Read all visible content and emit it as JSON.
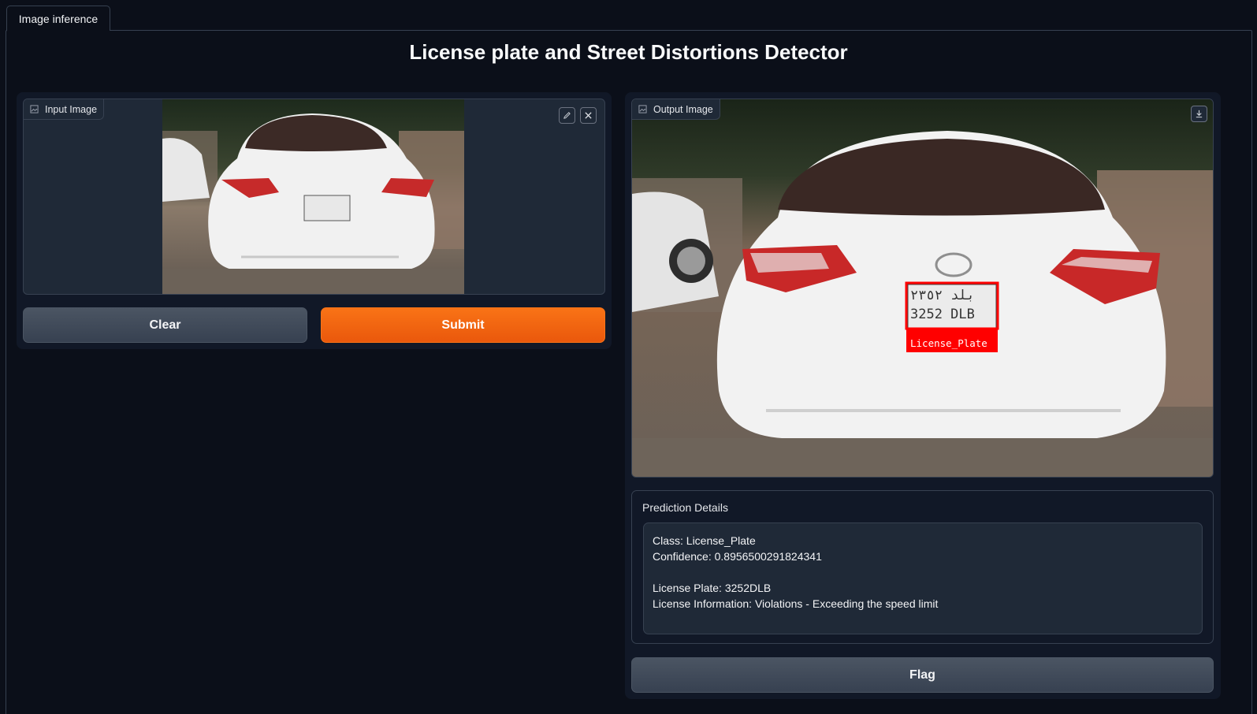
{
  "tabs": [
    {
      "label": "Image inference"
    }
  ],
  "header": {
    "title": "License plate and Street Distortions Detector"
  },
  "input": {
    "label": "Input Image",
    "edit_icon": "pencil-icon",
    "close_icon": "close-icon",
    "image_icon": "image-icon"
  },
  "buttons": {
    "clear": "Clear",
    "submit": "Submit",
    "flag": "Flag"
  },
  "output": {
    "label": "Output Image",
    "download_icon": "download-icon",
    "detection_label": "License_Plate",
    "plate_top_text": "بلد ٢٣٥٢",
    "plate_bottom_text": "3252 DLB"
  },
  "prediction": {
    "label": "Prediction Details",
    "lines": [
      "Class: License_Plate",
      "Confidence: 0.8956500291824341",
      "",
      "License Plate: 3252DLB",
      "License Information: Violations - Exceeding the speed limit"
    ]
  },
  "colors": {
    "background": "#0b0f19",
    "primary": "#f97316",
    "detection_box": "#ff0000"
  }
}
